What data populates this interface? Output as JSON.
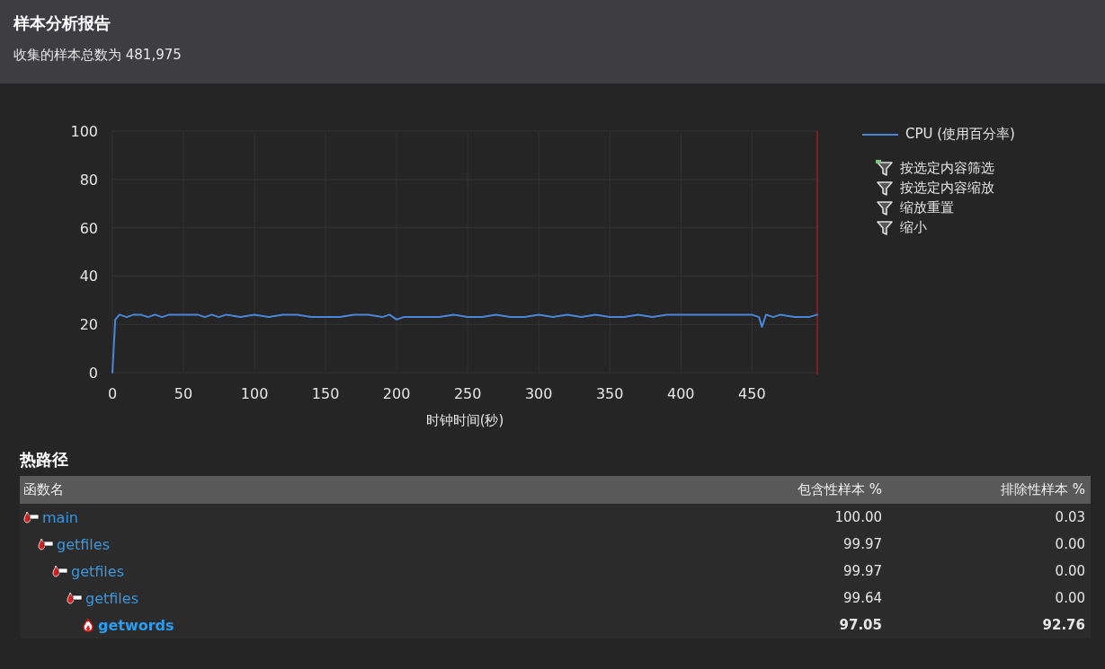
{
  "header": {
    "title": "样本分析报告",
    "subtitle": "收集的样本总数为 481,975"
  },
  "chart": {
    "chart_data": {
      "type": "line",
      "xlabel": "时钟时间(秒)",
      "grid": true,
      "xlim": [
        0,
        496
      ],
      "ylim": [
        0,
        100
      ],
      "xticks": [
        0,
        50,
        100,
        150,
        200,
        250,
        300,
        350,
        400,
        450
      ],
      "yticks": [
        0,
        20,
        40,
        60,
        80,
        100
      ],
      "x": [
        0,
        2,
        5,
        10,
        15,
        20,
        25,
        30,
        35,
        40,
        45,
        50,
        55,
        60,
        65,
        70,
        75,
        80,
        90,
        100,
        110,
        120,
        130,
        140,
        150,
        160,
        170,
        180,
        190,
        195,
        200,
        205,
        210,
        220,
        230,
        240,
        250,
        260,
        270,
        280,
        290,
        300,
        310,
        320,
        330,
        340,
        350,
        360,
        370,
        380,
        390,
        400,
        410,
        420,
        430,
        440,
        450,
        455,
        457,
        460,
        465,
        470,
        480,
        490,
        496
      ],
      "series": [
        {
          "name": "CPU (使用百分率)",
          "color": "#4a86d8",
          "values": [
            0,
            22,
            24,
            23,
            24,
            24,
            23,
            24,
            23,
            24,
            24,
            24,
            24,
            24,
            23,
            24,
            23,
            24,
            23,
            24,
            23,
            24,
            24,
            23,
            23,
            23,
            24,
            24,
            23,
            24,
            22,
            23,
            23,
            23,
            23,
            24,
            23,
            23,
            24,
            23,
            23,
            24,
            23,
            24,
            23,
            24,
            23,
            23,
            24,
            23,
            24,
            24,
            24,
            24,
            24,
            24,
            24,
            23,
            19,
            24,
            23,
            24,
            23,
            23,
            24
          ]
        }
      ]
    }
  },
  "legend_actions": [
    {
      "label": "按选定内容筛选",
      "highlighted": true
    },
    {
      "label": "按选定内容缩放",
      "highlighted": false
    },
    {
      "label": "缩放重置",
      "highlighted": false
    },
    {
      "label": "缩小",
      "highlighted": false
    }
  ],
  "hot_path": {
    "title": "热路径",
    "columns": [
      "函数名",
      "包含性样本 %",
      "排除性样本 %"
    ],
    "rows": [
      {
        "name": "main",
        "inclusive": "100.00",
        "exclusive": "0.03",
        "hot": false,
        "children": [
          {
            "name": "getfiles",
            "inclusive": "99.97",
            "exclusive": "0.00",
            "hot": false,
            "children": [
              {
                "name": "getfiles",
                "inclusive": "99.97",
                "exclusive": "0.00",
                "hot": false,
                "children": [
                  {
                    "name": "getfiles",
                    "inclusive": "99.64",
                    "exclusive": "0.00",
                    "hot": false,
                    "children": [
                      {
                        "name": "getwords",
                        "inclusive": "97.05",
                        "exclusive": "92.76",
                        "hot": true
                      }
                    ]
                  }
                ]
              }
            ]
          }
        ]
      }
    ]
  }
}
